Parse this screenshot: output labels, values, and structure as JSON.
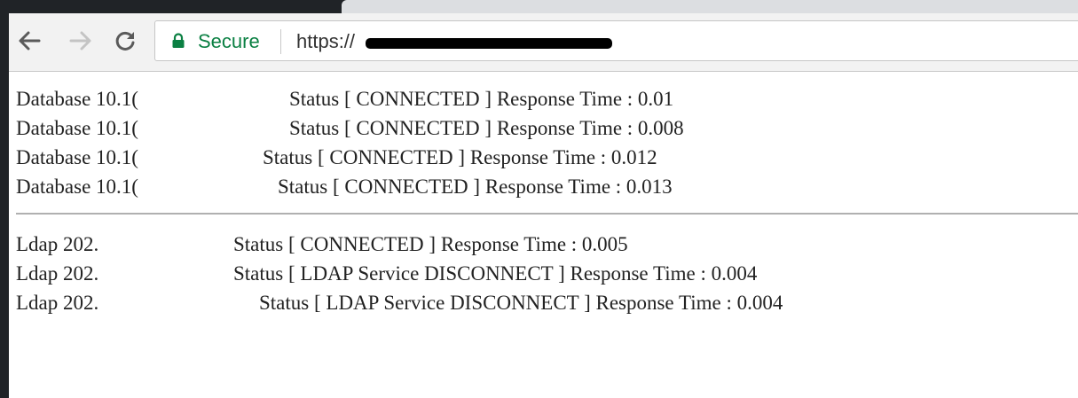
{
  "browser": {
    "secure_label": "Secure",
    "url": "https://"
  },
  "database_rows": [
    {
      "name": "Database 10.1(",
      "status": "Status [ CONNECTED ] Response Time : 0.01"
    },
    {
      "name": "Database 10.1(",
      "status": "Status [ CONNECTED ] Response Time : 0.008"
    },
    {
      "name": "Database 10.1(",
      "status": "Status [ CONNECTED ] Response Time : 0.012"
    },
    {
      "name": "Database 10.1(",
      "status": "Status [ CONNECTED ] Response Time : 0.013"
    }
  ],
  "ldap_rows": [
    {
      "name": "Ldap 202.",
      "status": "Status [ CONNECTED ] Response Time : 0.005"
    },
    {
      "name": "Ldap 202.",
      "status": "Status [ LDAP Service DISCONNECT ] Response Time : 0.004"
    },
    {
      "name": "Ldap 202.",
      "status": "Status [ LDAP Service DISCONNECT ] Response Time : 0.004"
    }
  ],
  "colors": {
    "secure": "#0b8043",
    "page_bg": "#ffffff",
    "toolbar_bg": "#f2f2f2"
  }
}
